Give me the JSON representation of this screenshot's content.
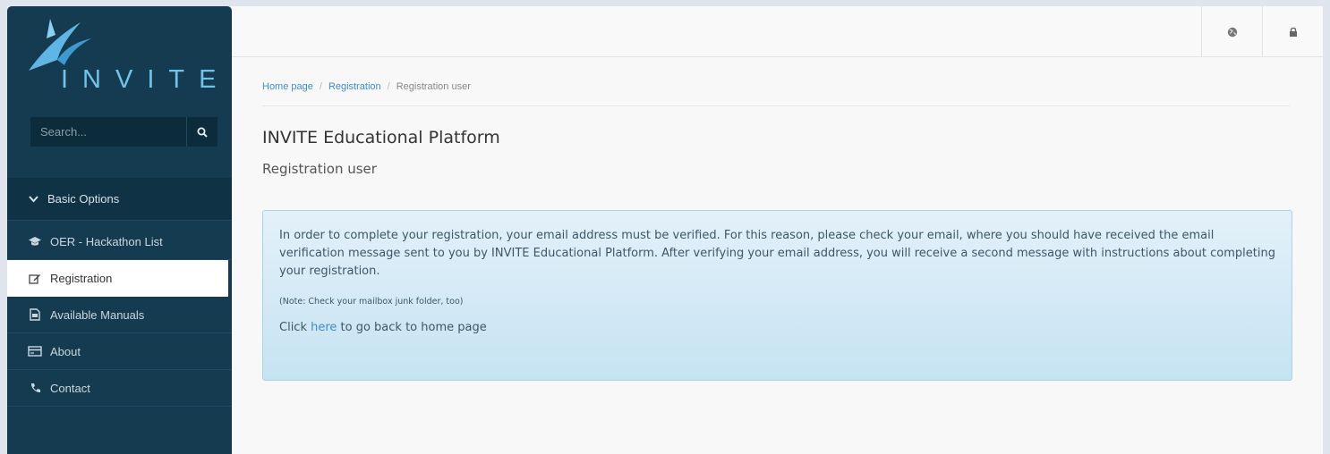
{
  "sidebar": {
    "logo_text": "INVITE",
    "search": {
      "placeholder": "Search..."
    },
    "section_label": "Basic Options",
    "items": [
      {
        "label": "OER - Hackathon List",
        "icon": "graduation-cap-icon"
      },
      {
        "label": "Registration",
        "icon": "edit-icon"
      },
      {
        "label": "Available Manuals",
        "icon": "file-icon"
      },
      {
        "label": "About",
        "icon": "card-icon"
      },
      {
        "label": "Contact",
        "icon": "phone-icon"
      }
    ]
  },
  "topbar": {
    "icons": [
      "globe-icon",
      "lock-icon"
    ]
  },
  "breadcrumb": {
    "home": "Home page",
    "registration": "Registration",
    "current": "Registration user",
    "separator": "/"
  },
  "page": {
    "title": "INVITE Educational Platform",
    "subtitle": "Registration user"
  },
  "alert": {
    "message": "In order to complete your registration, your email address must be verified. For this reason, please check your email, where you should have received the email verification message sent to you by INVITE Educational Platform. After verifying your email address, you will receive a second message with instructions about completing your registration.",
    "note": "(Note: Check your mailbox junk folder, too)",
    "back_prefix": "Click ",
    "back_link": "here",
    "back_suffix": " to go back to home page"
  },
  "colors": {
    "sidebar_bg": "#143b50",
    "accent": "#6fc3ec",
    "link": "#3f8bd1",
    "alert_bg": "#d4ebf7"
  }
}
